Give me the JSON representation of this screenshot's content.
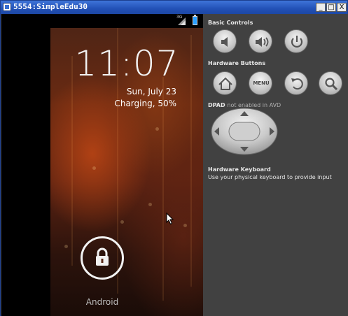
{
  "window": {
    "title": "5554:SimpleEdu30",
    "minimize_label": "_",
    "maximize_label": "□",
    "close_label": "X"
  },
  "statusbar": {
    "network_label": "3G"
  },
  "lockscreen": {
    "time": "11:07",
    "date": "Sun, July 23",
    "charging": "Charging, 50%",
    "carrier": "Android"
  },
  "panel": {
    "basic_controls_title": "Basic Controls",
    "hardware_buttons_title": "Hardware Buttons",
    "menu_label": "MENU",
    "dpad_title": "DPAD",
    "dpad_note": "not enabled in AVD",
    "keyboard_title": "Hardware Keyboard",
    "keyboard_desc": "Use your physical keyboard to provide input"
  },
  "colors": {
    "titlebar": "#2251b6",
    "panel_bg": "#414141",
    "battery": "#2aa0ff"
  }
}
